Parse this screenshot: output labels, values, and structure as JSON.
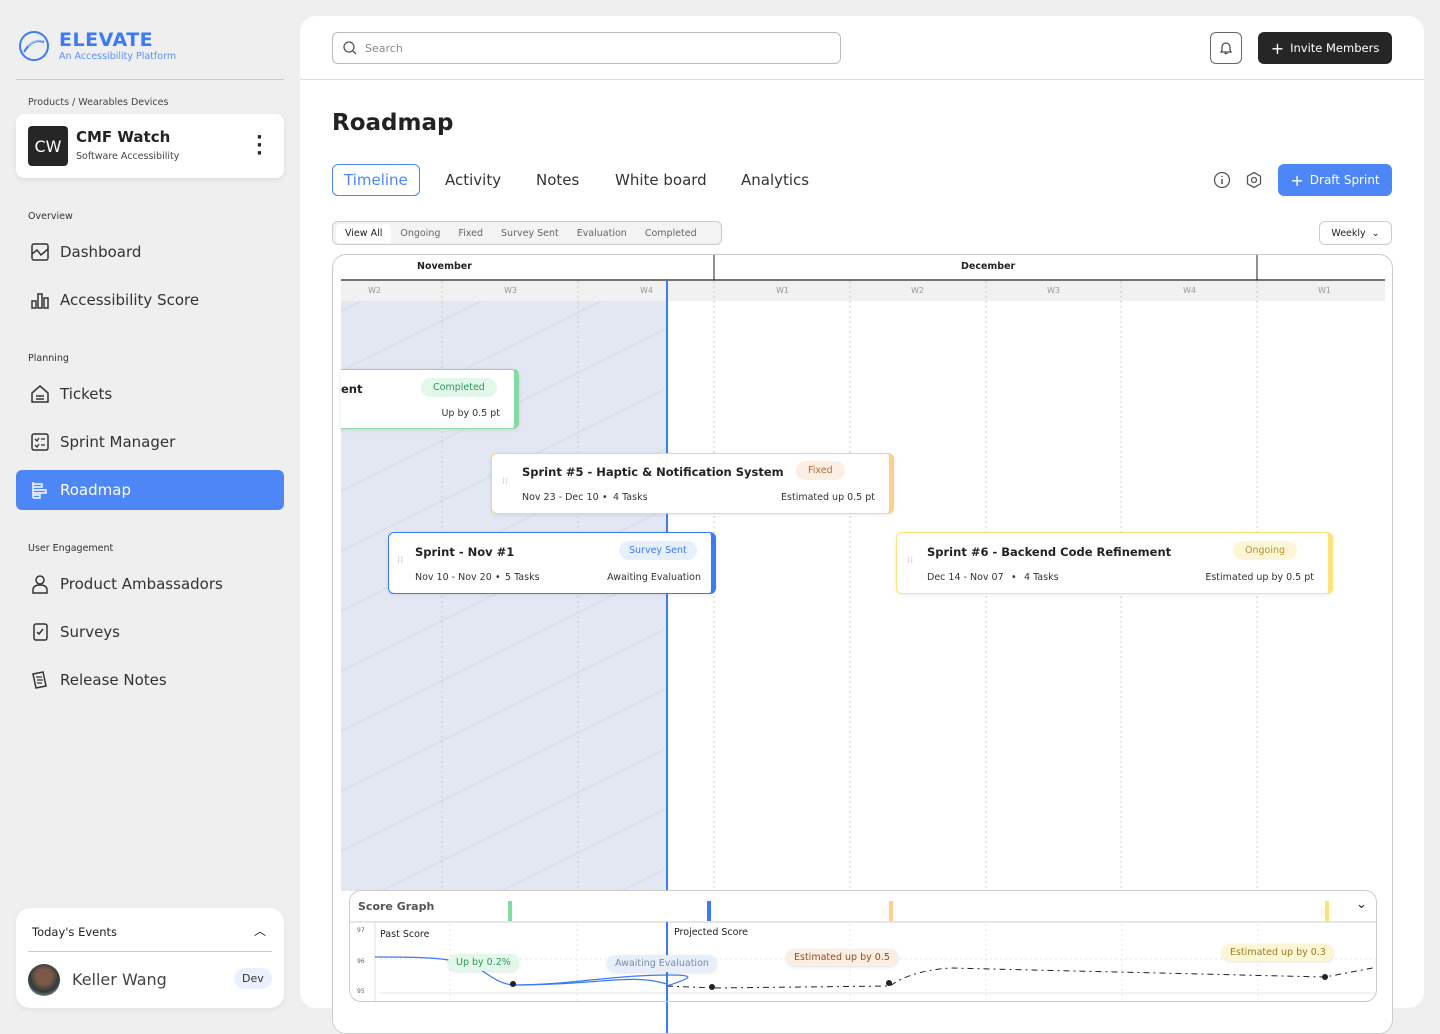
{
  "brand": {
    "name": "ELEVATE",
    "tagline": "An Accessibility Platform"
  },
  "breadcrumb": "Products / Wearables Devices",
  "product": {
    "initials": "CW",
    "name": "CMF Watch",
    "subtitle": "Software Accessibility"
  },
  "sidebar": {
    "sections": [
      "Overview",
      "Planning",
      "User Engagement"
    ],
    "items": [
      {
        "label": "Dashboard"
      },
      {
        "label": "Accessibility Score"
      },
      {
        "label": "Tickets"
      },
      {
        "label": "Sprint Manager"
      },
      {
        "label": "Roadmap"
      },
      {
        "label": "Product Ambassadors"
      },
      {
        "label": "Surveys"
      },
      {
        "label": "Release Notes"
      }
    ]
  },
  "events": {
    "title": "Today's Events",
    "person": "Keller Wang",
    "role": "Dev"
  },
  "header": {
    "search_placeholder": "Search",
    "invite_label": "Invite Members"
  },
  "page": {
    "title": "Roadmap",
    "tabs": [
      "Timeline",
      "Activity",
      "Notes",
      "White board",
      "Analytics"
    ],
    "draft_label": "Draft Sprint"
  },
  "filters": [
    "View All",
    "Ongoing",
    "Fixed",
    "Survey Sent",
    "Evaluation",
    "Completed"
  ],
  "view_select": "Weekly",
  "timeline": {
    "months": [
      "November",
      "December"
    ],
    "weeks": [
      "W2",
      "W3",
      "W4",
      "W1",
      "W2",
      "W3",
      "W4",
      "W1"
    ],
    "cards": [
      {
        "title": "ent",
        "status": "Completed",
        "note": "Up by 0.5 pt",
        "color": "#86d9a0"
      },
      {
        "title": "Sprint #5 - Haptic & Notification System",
        "status": "Fixed",
        "dates": "Nov 23 - Dec 10",
        "tasks": "4 Tasks",
        "note": "Estimated up 0.5 pt",
        "color": "#fcd089"
      },
      {
        "title": "Sprint - Nov #1",
        "status": "Survey Sent",
        "dates": "Nov 10 - Nov 20",
        "tasks": "5 Tasks",
        "note": "Awaiting Evaluation",
        "color": "#3b7bf6"
      },
      {
        "title": "Sprint #6 - Backend Code Refinement",
        "status": "Ongoing",
        "dates": "Dec 14 - Nov 07",
        "tasks": "4 Tasks",
        "note": "Estimated up by 0.5 pt",
        "color": "#fbe27a"
      }
    ]
  },
  "score_graph": {
    "title": "Score Graph",
    "y_ticks": [
      "97",
      "96",
      "95"
    ],
    "past_label": "Past Score",
    "projected_label": "Projected Score",
    "annotations": [
      "Up by 0.2%",
      "Awaiting Evaluation",
      "Estimated up by 0.5",
      "Estimated up by 0.3"
    ]
  }
}
